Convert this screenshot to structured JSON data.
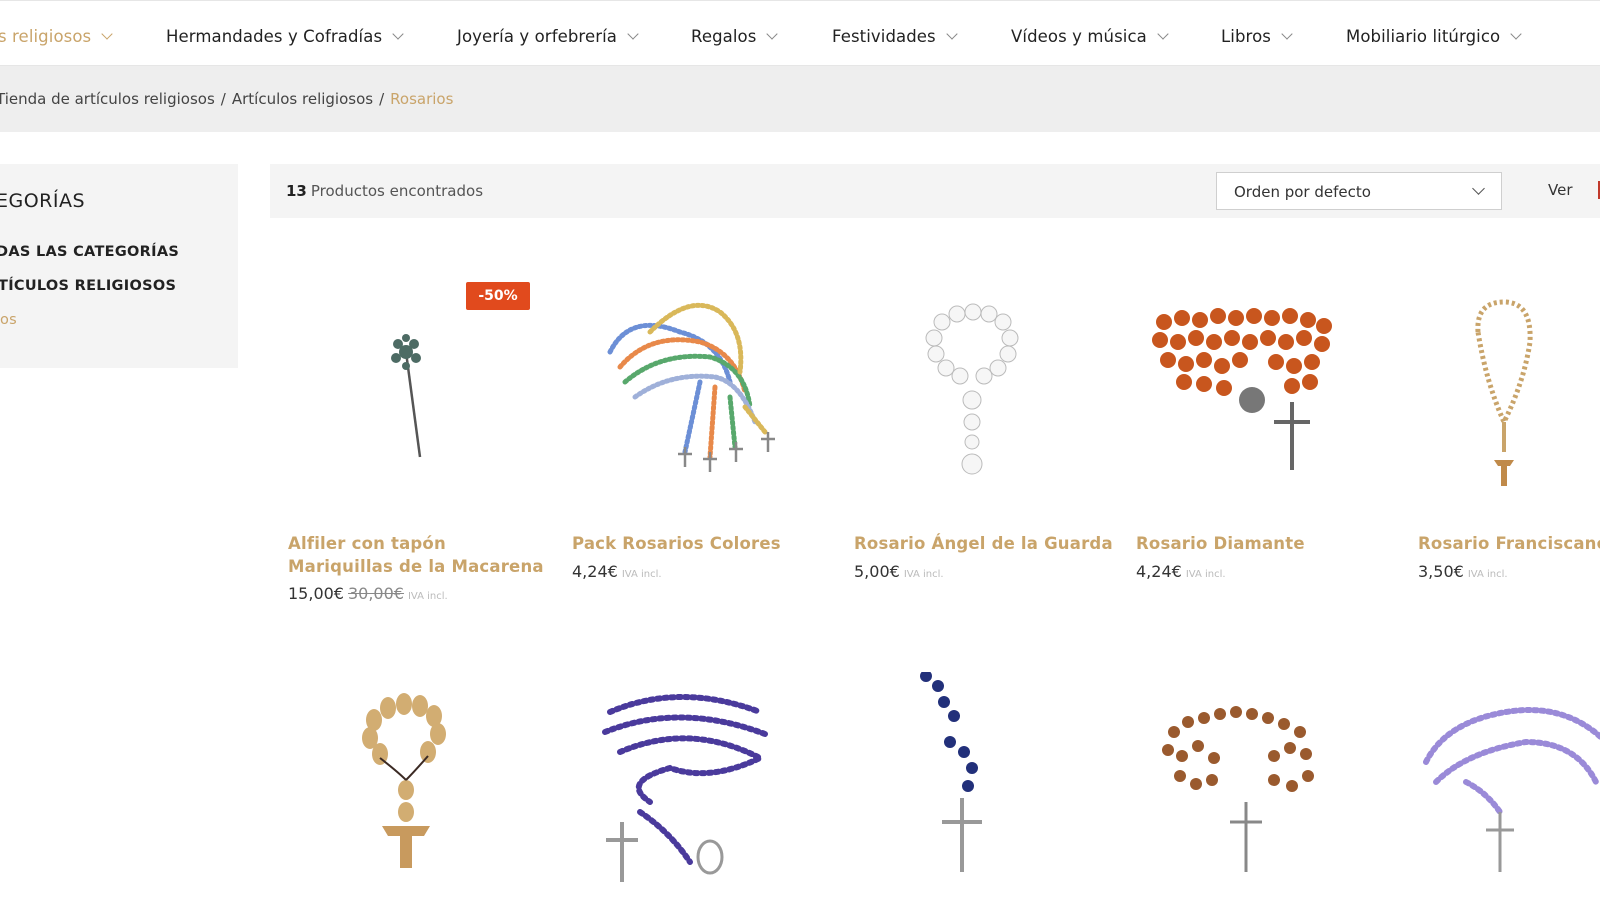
{
  "nav": {
    "items": [
      {
        "label": "s religiosos",
        "active": true
      },
      {
        "label": "Hermandades y Cofradías"
      },
      {
        "label": "Joyería y orfebrería"
      },
      {
        "label": "Regalos"
      },
      {
        "label": "Festividades"
      },
      {
        "label": "Vídeos y música"
      },
      {
        "label": "Libros"
      },
      {
        "label": "Mobiliario litúrgico"
      }
    ]
  },
  "breadcrumb": {
    "items": [
      "Tienda de artículos religiosos",
      "Artículos religiosos"
    ],
    "separator": "/",
    "current": "Rosarios"
  },
  "sidebar": {
    "title": "EGORÍAS",
    "links": [
      "DAS LAS CATEGORÍAS",
      "TÍCULOS RELIGIOSOS",
      "os"
    ]
  },
  "toolbar": {
    "count": "13",
    "count_label": "Productos encontrados",
    "sort_value": "Orden por defecto",
    "view_label": "Ver"
  },
  "products": [
    {
      "name_line1": "Alfiler con tapón",
      "name_line2": "Mariquillas de la Macarena",
      "price": "15,00€",
      "old_price": "30,00€",
      "tax": "IVA incl.",
      "badge": "-50%",
      "image": "pin-icon"
    },
    {
      "name_line1": "Pack Rosarios Colores",
      "price": "4,24€",
      "tax": "IVA incl.",
      "image": "multicolor-rosaries-icon"
    },
    {
      "name_line1": "Rosario Ángel de la Guarda",
      "price": "5,00€",
      "tax": "IVA incl.",
      "image": "pearl-rosary-icon"
    },
    {
      "name_line1": "Rosario Diamante",
      "price": "4,24€",
      "tax": "IVA incl.",
      "image": "orange-rosary-icon"
    },
    {
      "name_line1": "Rosario Franciscano",
      "price": "3,50€",
      "tax": "IVA incl.",
      "image": "franciscan-rosary-icon"
    },
    {
      "image": "wooden-decade-rosary-icon"
    },
    {
      "image": "blue-purple-rosary-icon"
    },
    {
      "image": "dark-blue-rosary-icon"
    },
    {
      "image": "brown-bead-rosary-icon"
    },
    {
      "image": "lilac-rosary-icon"
    }
  ],
  "colors": {
    "accent": "#c9a46a",
    "badge": "#e14a1d"
  }
}
